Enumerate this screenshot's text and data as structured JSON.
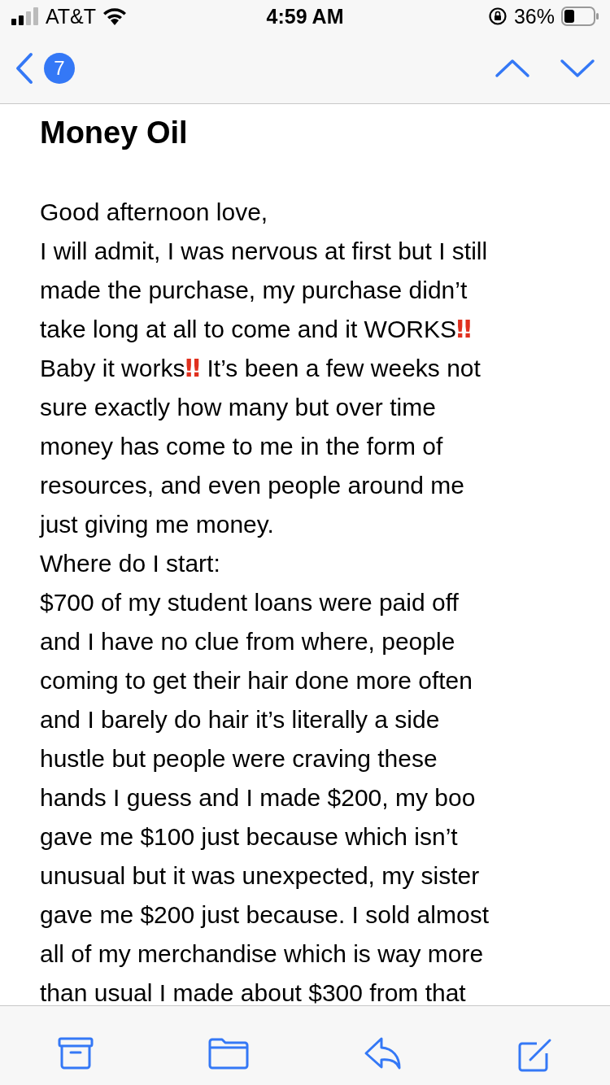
{
  "status_bar": {
    "carrier": "AT&T",
    "time": "4:59 AM",
    "battery": "36%"
  },
  "nav": {
    "unread_count": "7"
  },
  "subject": "Money Oil",
  "body_lines": [
    [
      {
        "text": "Good afternoon love,"
      }
    ],
    [
      {
        "text": "I will admit, I was nervous at first but I still"
      }
    ],
    [
      {
        "text": "made the purchase, my purchase didn’t"
      }
    ],
    [
      {
        "text": "take long at all to come and it WORKS"
      },
      {
        "text": "‼",
        "kind": "emoji"
      }
    ],
    [
      {
        "text": "Baby it works"
      },
      {
        "text": "‼",
        "kind": "emoji"
      },
      {
        "text": " It’s been a few weeks not"
      }
    ],
    [
      {
        "text": "sure exactly how many but over time"
      }
    ],
    [
      {
        "text": "money has come to me in the form of"
      }
    ],
    [
      {
        "text": "resources, and even people around me"
      }
    ],
    [
      {
        "text": "just giving me money."
      }
    ],
    [
      {
        "text": "Where do I start:"
      }
    ],
    [
      {
        "text": "$700 of my student loans were paid off"
      }
    ],
    [
      {
        "text": "and I have no clue from where, people"
      }
    ],
    [
      {
        "text": "coming to get their hair done more often"
      }
    ],
    [
      {
        "text": "and I barely do hair it’s literally a side"
      }
    ],
    [
      {
        "text": "hustle but people were craving these"
      }
    ],
    [
      {
        "text": "hands I guess and I made $200, my boo"
      }
    ],
    [
      {
        "text": "gave me $100 just because which isn’t"
      }
    ],
    [
      {
        "text": "unusual but it was unexpected, my sister"
      }
    ],
    [
      {
        "text": "gave me $200 just because. I sold almost"
      }
    ],
    [
      {
        "text": "all of my merchandise which is way more"
      }
    ],
    [
      {
        "text": "than usual I made about $300 from that"
      }
    ]
  ]
}
